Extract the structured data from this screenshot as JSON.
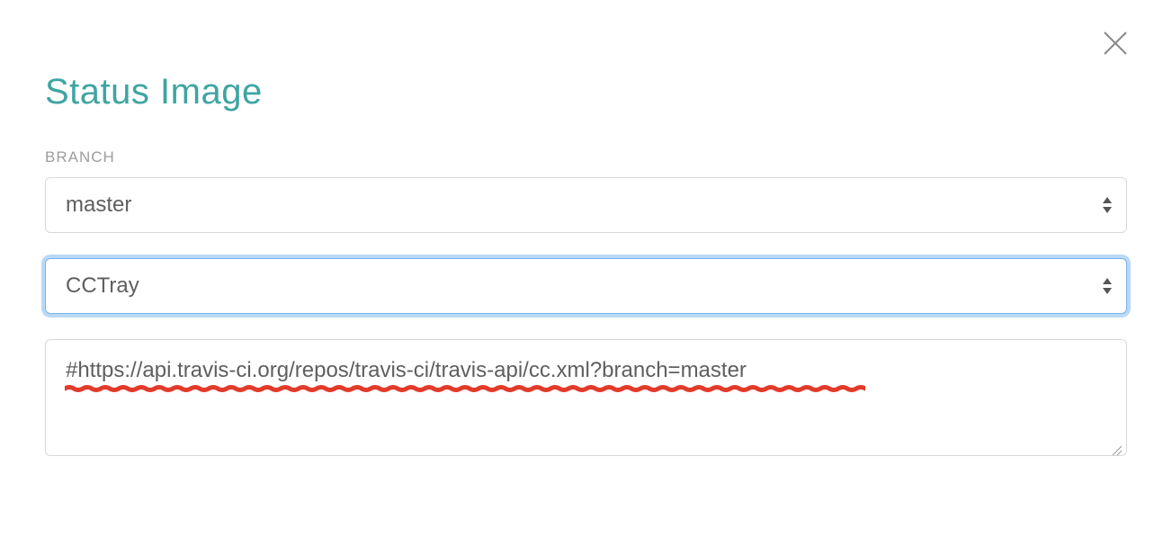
{
  "title": "Status Image",
  "branch": {
    "label": "BRANCH",
    "selected": "master"
  },
  "format": {
    "selected": "CCTray"
  },
  "url_output": "#https://api.travis-ci.org/repos/travis-ci/travis-api/cc.xml?branch=master"
}
